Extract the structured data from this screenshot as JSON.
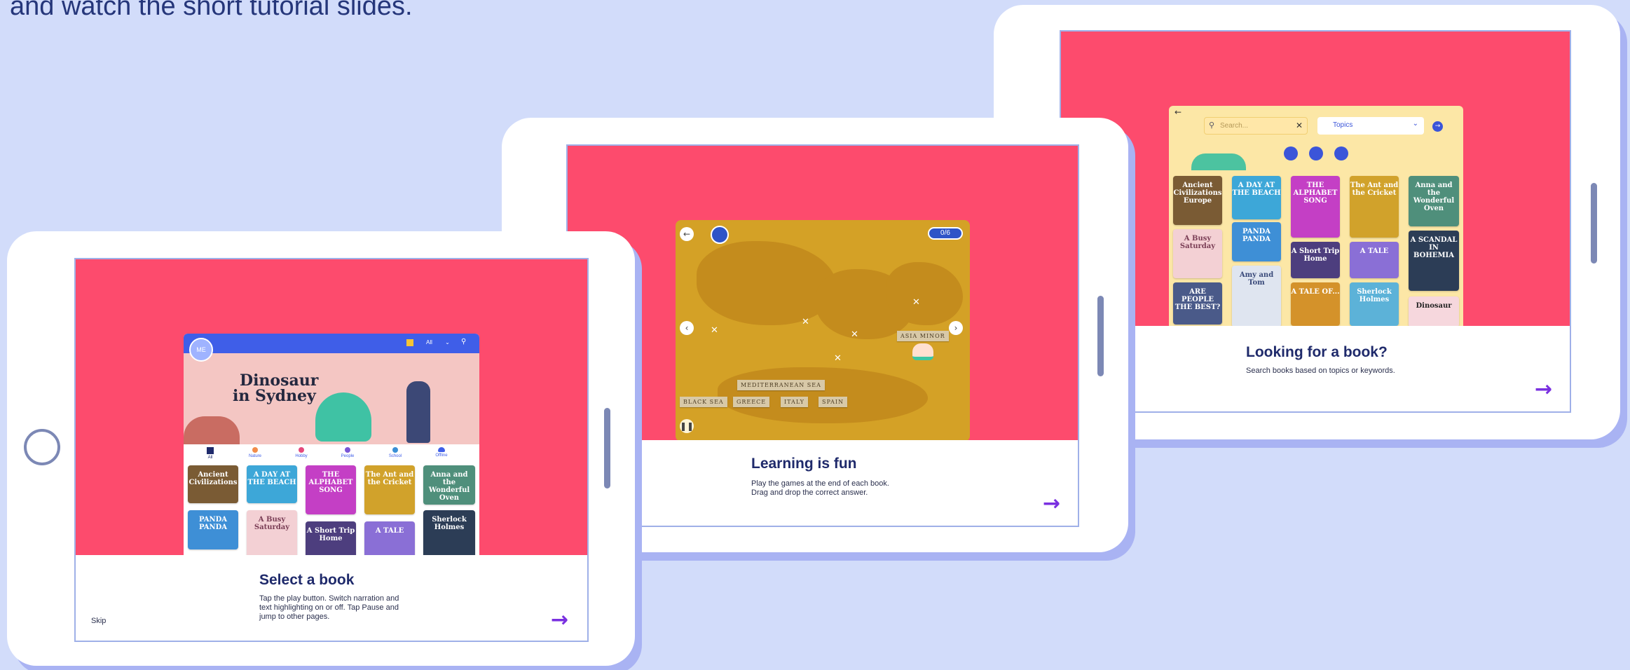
{
  "headline": "and watch the short tutorial slides.",
  "slides": {
    "select": {
      "title": "Select a book",
      "desc1": "Tap the play button. Switch narration and",
      "desc2": "text highlighting on or off. Tap Pause and",
      "desc3": "jump to other pages.",
      "skip": "Skip",
      "app": {
        "avatar": "ME",
        "filter": "All",
        "hero_title_1": "Dinosaur",
        "hero_title_2": "in Sydney",
        "categories": [
          "All",
          "Nature",
          "Hobby",
          "People",
          "School",
          "Offline"
        ],
        "books": [
          "Ancient Civilizations",
          "A DAY AT THE BEACH",
          "THE ALPHABET SONG",
          "The Ant and the Cricket",
          "Anna and the Wonderful Oven",
          "PANDA PANDA",
          "A Busy Saturday",
          "A Short Trip Home",
          "A TALE",
          "Sherlock Holmes"
        ]
      }
    },
    "learning": {
      "title": "Learning is fun",
      "desc1": "Play the games at the end of each book.",
      "desc2": "Drag and drop the correct answer.",
      "game": {
        "score": "0/6",
        "target_label": "ASIA MINOR",
        "words": [
          "MEDITERRANEAN SEA",
          "BLACK SEA",
          "GREECE",
          "ITALY",
          "SPAIN"
        ]
      }
    },
    "looking": {
      "title": "Looking for a book?",
      "desc1": "Search books based on topics or keywords.",
      "app": {
        "search_placeholder": "Search...",
        "topics": "Topics",
        "books": [
          "Ancient Civilizations Europe",
          "A DAY AT THE BEACH",
          "THE ALPHABET SONG",
          "The Ant and the Cricket",
          "Anna and the Wonderful Oven",
          "PANDA PANDA",
          "A Busy Saturday",
          "A Short Trip Home",
          "A TALE",
          "A SCANDAL IN BOHEMIA",
          "ARE PEOPLE THE BEST?",
          "Amy and Tom",
          "A TALE OF...",
          "Sherlock Holmes",
          "Dinosaur"
        ]
      }
    }
  },
  "colors": {
    "pink": "#fd4b6d",
    "navy": "#1f2a6b",
    "arrow": "#7a30e0",
    "background": "#d2dcfa"
  }
}
